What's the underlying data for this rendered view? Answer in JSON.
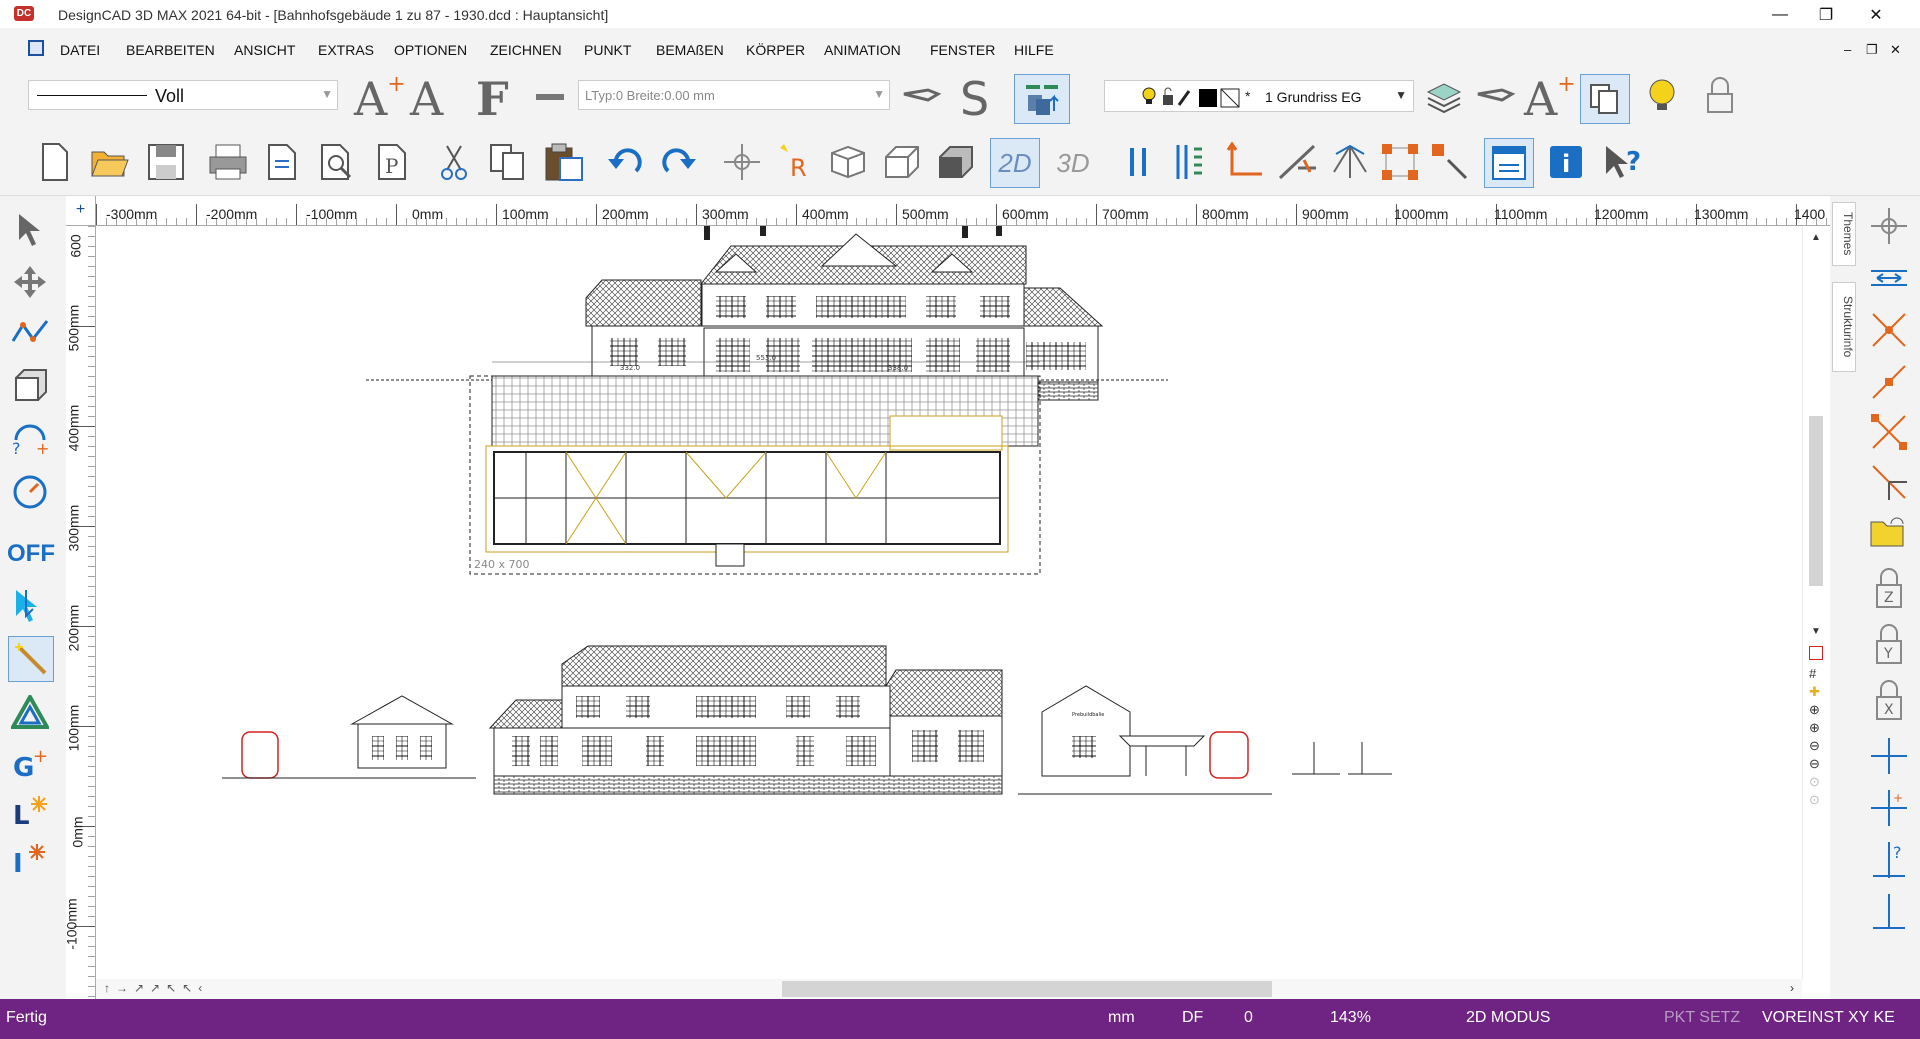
{
  "window": {
    "title": "DesignCAD 3D MAX 2021 64-bit - [Bahnhofsgebäude 1 zu 87 - 1930.dcd : Hauptansicht]",
    "logo": "DC",
    "minimize": "—",
    "restore": "❐",
    "close": "✕"
  },
  "menu": {
    "items": [
      "DATEI",
      "BEARBEITEN",
      "ANSICHT",
      "EXTRAS",
      "OPTIONEN",
      "ZEICHNEN",
      "PUNKT",
      "BEMAßEN",
      "KÖRPER",
      "ANIMATION",
      "FENSTER",
      "HILFE"
    ],
    "mdi_min": "–",
    "mdi_restore": "❐",
    "mdi_close": "✕"
  },
  "toolbar1": {
    "line_style_label": "Voll",
    "line_type_text": "LTyp:0  Breite:0.00 mm",
    "layer_star": "*",
    "layer_text": "1  Grundriss EG"
  },
  "toolbar2": {
    "mode_2d": "2D",
    "mode_3d": "3D"
  },
  "left_panel": {
    "off_label": "OFF"
  },
  "right_tabs": {
    "themes": "Themes",
    "strukturinfo": "Strukturinfo"
  },
  "ruler_top": {
    "labels": [
      "-300mm",
      "-200mm",
      "-100mm",
      "0mm",
      "100mm",
      "200mm",
      "300mm",
      "400mm",
      "500mm",
      "600mm",
      "700mm",
      "800mm",
      "900mm",
      "1000mm",
      "1100mm",
      "1200mm",
      "1300mm",
      "1400"
    ]
  },
  "ruler_left": {
    "labels": [
      "600",
      "500mm",
      "400mm",
      "300mm",
      "200mm",
      "100mm",
      "0mm",
      "-100mm"
    ]
  },
  "drawing": {
    "dim_total": "553.0",
    "dim_left": "332.0",
    "dim_right": "338.0",
    "frame_label": "240 x 700",
    "sign_text": "Prebuildbalie"
  },
  "statusbar": {
    "status": "Fertig",
    "unit": "mm",
    "df": "DF",
    "df_value": "0",
    "zoom": "143%",
    "mode": "2D MODUS",
    "pkt": "PKT SETZ",
    "voreinst": "VOREINST XY KE"
  }
}
